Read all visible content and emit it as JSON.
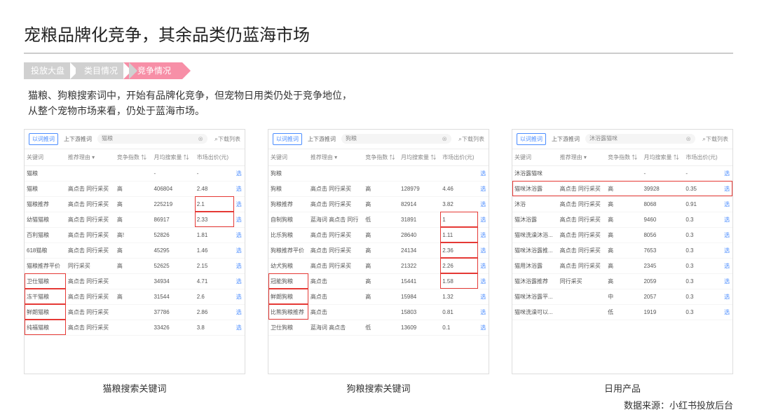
{
  "title": "宠粮品牌化竞争，其余品类仍蓝海市场",
  "breadcrumb": [
    "投放大盘",
    "类目情况",
    "竞争情况"
  ],
  "desc": {
    "line1": "猫粮、狗粮搜索词中，开始有品牌化竞争，但宠物日用类仍处于竞争地位，",
    "line2": "从整个宠物市场来看，仍处于蓝海市场。"
  },
  "panel_tabs": [
    "以词推词",
    "上下游推词"
  ],
  "download": "下载列表",
  "columns": [
    "关键词",
    "推荐理由 ▾",
    "竞争指数 ⇅",
    "月均搜索量 ⇅",
    "市场出价(元)",
    ""
  ],
  "action_label": "选",
  "panels": [
    {
      "search": "猫粮",
      "caption": "猫粮搜索关键词",
      "rows": [
        {
          "kw": "猫粮",
          "reason": "",
          "comp": "",
          "vol": "-",
          "bid": "-",
          "hl_kw": false,
          "hl_bid": false
        },
        {
          "kw": "猫粮",
          "reason": "高点击  同行采买",
          "comp": "高",
          "vol": "406804",
          "bid": "2.48",
          "hl_kw": false,
          "hl_bid": false
        },
        {
          "kw": "猫粮推荐",
          "reason": "高点击  同行采买",
          "comp": "高",
          "vol": "225219",
          "bid": "2.1",
          "hl_kw": false,
          "hl_bid": true
        },
        {
          "kw": "幼猫猫粮",
          "reason": "高点击  同行采买",
          "comp": "高",
          "vol": "86917",
          "bid": "2.33",
          "hl_kw": false,
          "hl_bid": true
        },
        {
          "kw": "百利猫粮",
          "reason": "高点击  同行采买",
          "comp": "高!",
          "vol": "52826",
          "bid": "1.81",
          "hl_kw": false,
          "hl_bid": false
        },
        {
          "kw": "618猫粮",
          "reason": "高点击  同行采买",
          "comp": "高",
          "vol": "45295",
          "bid": "1.46",
          "hl_kw": false,
          "hl_bid": false
        },
        {
          "kw": "猫粮推荐平价",
          "reason": "同行采买",
          "comp": "高",
          "vol": "52625",
          "bid": "2.15",
          "hl_kw": false,
          "hl_bid": false
        },
        {
          "kw": "卫仕猫粮",
          "reason": "高点击  同行采买",
          "comp": "",
          "vol": "34934",
          "bid": "4.71",
          "hl_kw": true,
          "hl_bid": false
        },
        {
          "kw": "冻干猫粮",
          "reason": "高点击  同行采买",
          "comp": "高",
          "vol": "31544",
          "bid": "2.6",
          "hl_kw": true,
          "hl_bid": false
        },
        {
          "kw": "鲜朗猫粮",
          "reason": "高点击  同行采买",
          "comp": "",
          "vol": "37786",
          "bid": "2.86",
          "hl_kw": true,
          "hl_bid": false
        },
        {
          "kw": "纯福猫粮",
          "reason": "高点击  同行采买",
          "comp": "",
          "vol": "33426",
          "bid": "3.8",
          "hl_kw": true,
          "hl_bid": false
        }
      ]
    },
    {
      "search": "狗粮",
      "caption": "狗粮搜索关键词",
      "rows": [
        {
          "kw": "狗粮",
          "reason": "",
          "comp": "",
          "vol": "",
          "bid": "",
          "hl_kw": false,
          "hl_bid": false
        },
        {
          "kw": "狗粮",
          "reason": "高点击  同行采买",
          "comp": "高",
          "vol": "128979",
          "bid": "4.46",
          "hl_kw": false,
          "hl_bid": false
        },
        {
          "kw": "狗粮推荐",
          "reason": "高点击  同行采买",
          "comp": "高",
          "vol": "82914",
          "bid": "3.82",
          "hl_kw": false,
          "hl_bid": false
        },
        {
          "kw": "自制狗粮",
          "reason": "蓝海词 高点击 同行",
          "comp": "低",
          "vol": "31891",
          "bid": "1",
          "hl_kw": false,
          "hl_bid": true
        },
        {
          "kw": "比乐狗粮",
          "reason": "高点击  同行采买",
          "comp": "高",
          "vol": "28640",
          "bid": "1.11",
          "hl_kw": false,
          "hl_bid": true
        },
        {
          "kw": "狗粮推荐平价",
          "reason": "高点击  同行采买",
          "comp": "高",
          "vol": "24134",
          "bid": "2.36",
          "hl_kw": false,
          "hl_bid": true
        },
        {
          "kw": "幼犬狗粮",
          "reason": "高点击  同行采买",
          "comp": "高",
          "vol": "21322",
          "bid": "2.26",
          "hl_kw": false,
          "hl_bid": true
        },
        {
          "kw": "冠能狗粮",
          "reason": "高点击",
          "comp": "高",
          "vol": "15441",
          "bid": "1.58",
          "hl_kw": true,
          "hl_bid": true
        },
        {
          "kw": "鲜朗狗粮",
          "reason": "高点击",
          "comp": "高",
          "vol": "15984",
          "bid": "1.32",
          "hl_kw": true,
          "hl_bid": false
        },
        {
          "kw": "比熊狗粮推荐",
          "reason": "高点击",
          "comp": "",
          "vol": "15803",
          "bid": "0.81",
          "hl_kw": true,
          "hl_bid": false
        },
        {
          "kw": "卫仕狗粮",
          "reason": "蓝海词 高点击",
          "comp": "低",
          "vol": "13609",
          "bid": "0.1",
          "hl_kw": false,
          "hl_bid": false
        }
      ]
    },
    {
      "search": "沐浴露猫咪",
      "caption": "日用产品",
      "rows": [
        {
          "kw": "沐浴露猫咪",
          "reason": "",
          "comp": "",
          "vol": "-",
          "bid": "-",
          "hl_kw": false,
          "hl_bid": false,
          "hl_row": false
        },
        {
          "kw": "猫咪沐浴露",
          "reason": "高点击  同行采买",
          "comp": "高",
          "vol": "39928",
          "bid": "0.35",
          "hl_kw": false,
          "hl_bid": false,
          "hl_row": true
        },
        {
          "kw": "沐浴",
          "reason": "高点击  同行采买",
          "comp": "高",
          "vol": "8068",
          "bid": "0.91",
          "hl_kw": false,
          "hl_bid": false
        },
        {
          "kw": "猫沐浴露",
          "reason": "高点击  同行采买",
          "comp": "高",
          "vol": "9460",
          "bid": "0.3",
          "hl_kw": false,
          "hl_bid": false
        },
        {
          "kw": "猫咪洗澡沐浴...",
          "reason": "高点击  同行采买",
          "comp": "高",
          "vol": "8056",
          "bid": "0.3",
          "hl_kw": false,
          "hl_bid": false
        },
        {
          "kw": "猫咪沐浴露推...",
          "reason": "高点击  同行采买",
          "comp": "高",
          "vol": "7653",
          "bid": "0.3",
          "hl_kw": false,
          "hl_bid": false
        },
        {
          "kw": "猫用沐浴露",
          "reason": "高点击  同行采买",
          "comp": "高",
          "vol": "2345",
          "bid": "0.3",
          "hl_kw": false,
          "hl_bid": false
        },
        {
          "kw": "猫沐浴露推荐",
          "reason": "同行采买",
          "comp": "高",
          "vol": "2059",
          "bid": "0.3",
          "hl_kw": false,
          "hl_bid": false
        },
        {
          "kw": "猫咪沐浴露平...",
          "reason": "",
          "comp": "中",
          "vol": "2057",
          "bid": "0.3",
          "hl_kw": false,
          "hl_bid": false
        },
        {
          "kw": "猫咪洗澡可以...",
          "reason": "",
          "comp": "低",
          "vol": "1919",
          "bid": "0.3",
          "hl_kw": false,
          "hl_bid": false
        }
      ]
    }
  ],
  "source": "数据来源：小红书投放后台"
}
